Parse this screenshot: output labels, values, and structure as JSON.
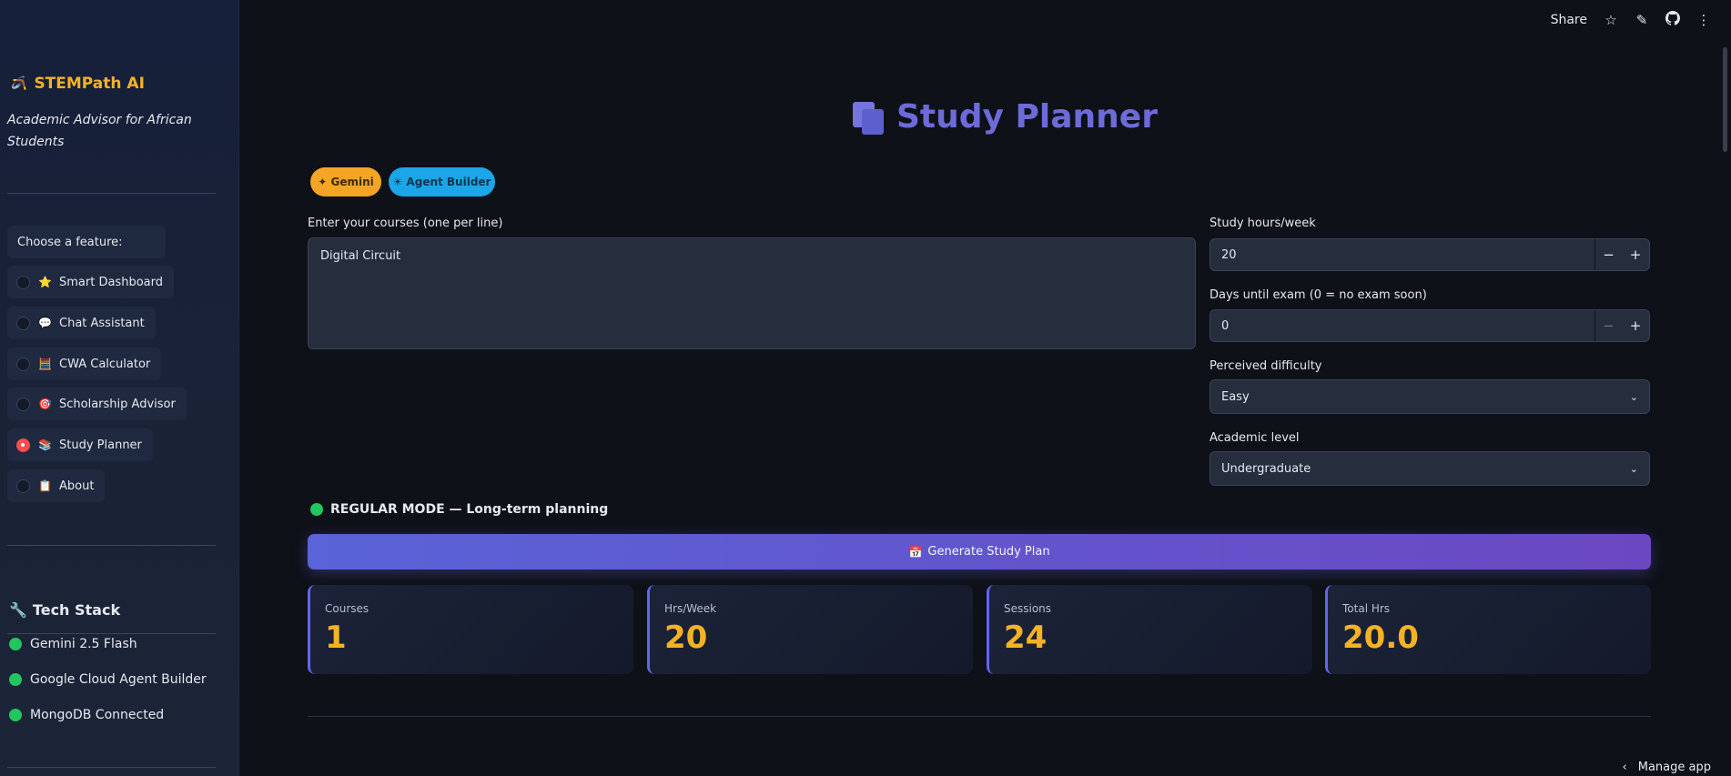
{
  "sidebar": {
    "brand_title": "STEMPath AI",
    "brand_icon": "🪃",
    "tagline": "Academic Advisor for African Students",
    "feature_label": "Choose a feature:",
    "items": [
      {
        "emoji": "⭐",
        "label": "Smart Dashboard"
      },
      {
        "emoji": "💬",
        "label": "Chat Assistant"
      },
      {
        "emoji": "🧮",
        "label": "CWA Calculator"
      },
      {
        "emoji": "🎯",
        "label": "Scholarship Advisor"
      },
      {
        "emoji": "📚",
        "label": "Study Planner"
      },
      {
        "emoji": "📋",
        "label": "About"
      }
    ],
    "selected_index": 4,
    "tech_heading": "Tech Stack",
    "tech_icon": "🔧",
    "tech_items": [
      "Gemini 2.5 Flash",
      "Google Cloud Agent Builder",
      "MongoDB Connected"
    ]
  },
  "topbar": {
    "share": "Share",
    "icons": [
      "star-icon",
      "edit-icon",
      "github-icon",
      "more-icon"
    ]
  },
  "main": {
    "title": "Study Planner",
    "pills": {
      "gemini": "✦ Gemini",
      "agent": "☀ Agent Builder"
    },
    "courses_label": "Enter your courses (one per line)",
    "courses_value": "Digital Circuit",
    "hours_label": "Study hours/week",
    "hours_value": "20",
    "days_label": "Days until exam (0 = no exam soon)",
    "days_value": "0",
    "difficulty_label": "Perceived difficulty",
    "difficulty_value": "Easy",
    "level_label": "Academic level",
    "level_value": "Undergraduate",
    "mode_text": "REGULAR MODE — Long-term planning",
    "generate_label": "Generate Study Plan",
    "metrics": [
      {
        "label": "Courses",
        "value": "1"
      },
      {
        "label": "Hrs/Week",
        "value": "20"
      },
      {
        "label": "Sessions",
        "value": "24"
      },
      {
        "label": "Total Hrs",
        "value": "20.0"
      }
    ]
  },
  "footer": {
    "manage": "Manage app"
  },
  "colors": {
    "accent": "#6d6bd8",
    "brand": "#f5b324",
    "status_green": "#22c55e",
    "selected_radio": "#ff4b4b"
  }
}
